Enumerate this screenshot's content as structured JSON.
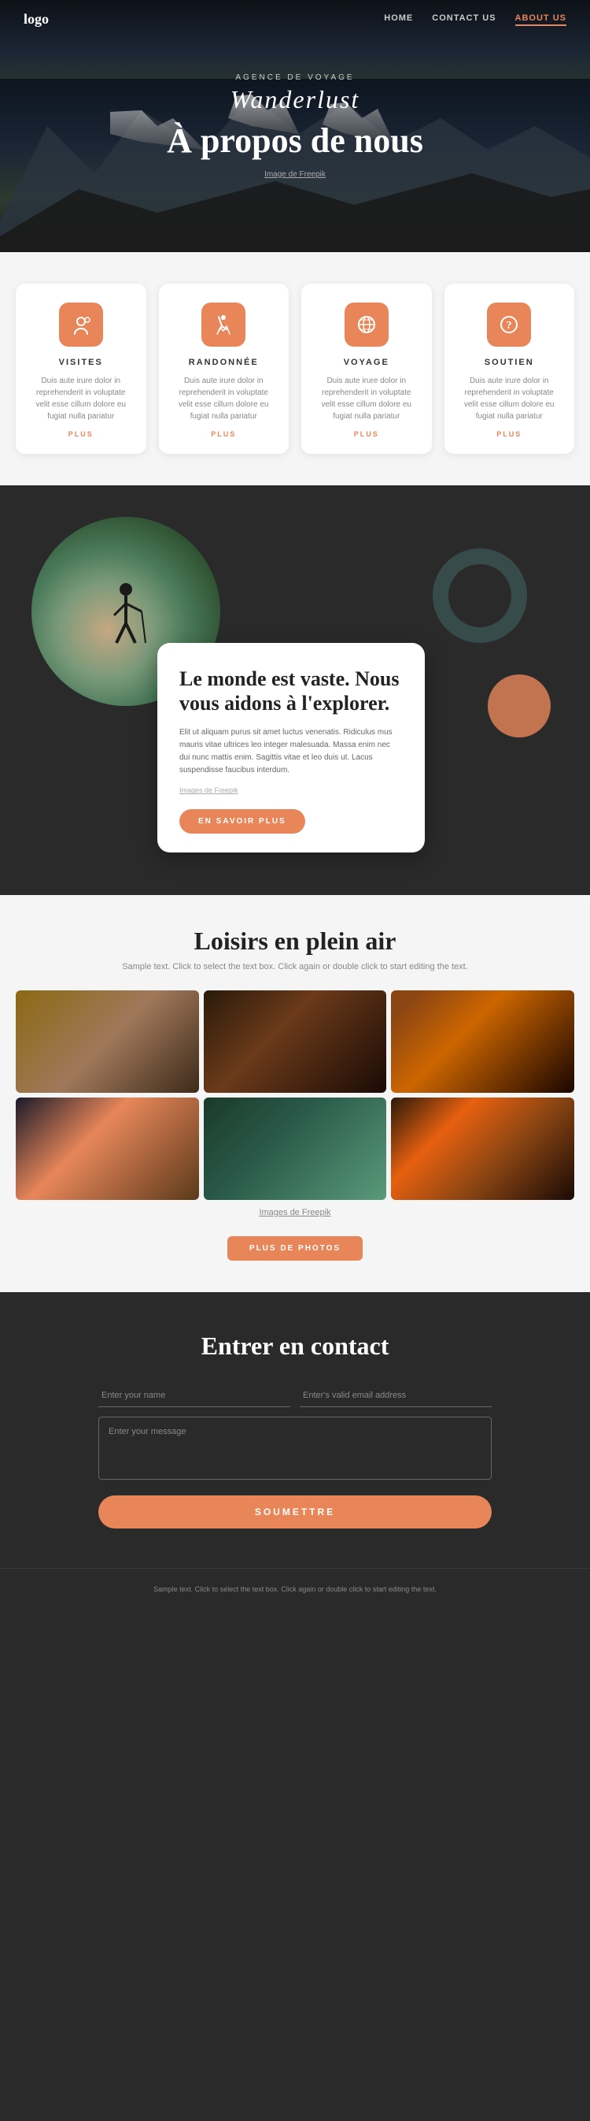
{
  "nav": {
    "logo": "logo",
    "links": [
      {
        "label": "HOME",
        "href": "#",
        "active": false
      },
      {
        "label": "CONTACT US",
        "href": "#",
        "active": false
      },
      {
        "label": "ABOUT US",
        "href": "#",
        "active": true
      }
    ]
  },
  "hero": {
    "agency_label": "AGENCE DE VOYAGE",
    "brand": "Wanderlust",
    "title": "À propos de nous",
    "credit": "Image de Freepik"
  },
  "cards": [
    {
      "icon": "🏔",
      "title": "VISITES",
      "text": "Duis aute irure dolor in reprehenderit in voluptate velit esse cillum dolore eu fugiat nulla pariatur",
      "link": "PLUS"
    },
    {
      "icon": "🥾",
      "title": "RANDONNÉE",
      "text": "Duis aute irure dolor in reprehenderit in voluptate velit esse cillum dolore eu fugiat nulla pariatur",
      "link": "PLUS"
    },
    {
      "icon": "🌐",
      "title": "VOYAGE",
      "text": "Duis aute irure dolor in reprehenderit in voluptate velit esse cillum dolore eu fugiat nulla pariatur",
      "link": "PLUS"
    },
    {
      "icon": "❓",
      "title": "SOUTIEN",
      "text": "Duis aute irure dolor in reprehenderit in voluptate velit esse cillum dolore eu fugiat nulla pariatur",
      "link": "PLUS"
    }
  ],
  "explore": {
    "title": "Le monde est vaste. Nous vous aidons à l'explorer.",
    "body": "Elit ut aliquam purus sit amet luctus venenatis. Ridiculus mus mauris vitae ultrices leo integer malesuada. Massa enim nec dui nunc mattis enim. Sagittis vitae et leo duis ut. Lacus suspendisse faucibus interdum.",
    "credit": "Images de Freepik",
    "button": "EN SAVOIR PLUS"
  },
  "loisirs": {
    "title": "Loisirs en plein air",
    "subtitle": "Sample text. Click to select the text box. Click again or double click to start editing the text.",
    "credit": "Images de Freepik",
    "button": "PLUS DE PHOTOS"
  },
  "contact": {
    "title": "Entrer en contact",
    "name_placeholder": "Enter your name",
    "email_placeholder": "Enter's valid email address",
    "message_placeholder": "Enter your message",
    "submit_label": "SOUMETTRE"
  },
  "footer": {
    "text": "Sample text. Click to select the text box. Click again or double\nclick to start editing the text."
  }
}
